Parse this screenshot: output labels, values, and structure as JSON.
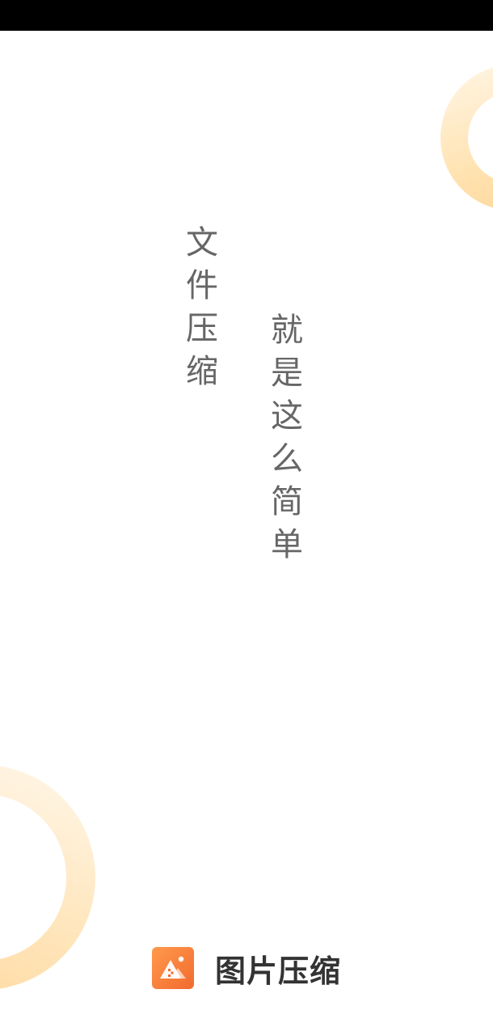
{
  "status_bar": {
    "color": "#000000"
  },
  "tagline": {
    "left_column": "文件压缩",
    "right_column": "就是这么简单",
    "text_color": "#666666"
  },
  "brand": {
    "icon": "image-compress-icon",
    "name": "图片压缩",
    "accent_color": "#f26a2e"
  },
  "decorations": {
    "ring_color": "#ffd596"
  }
}
